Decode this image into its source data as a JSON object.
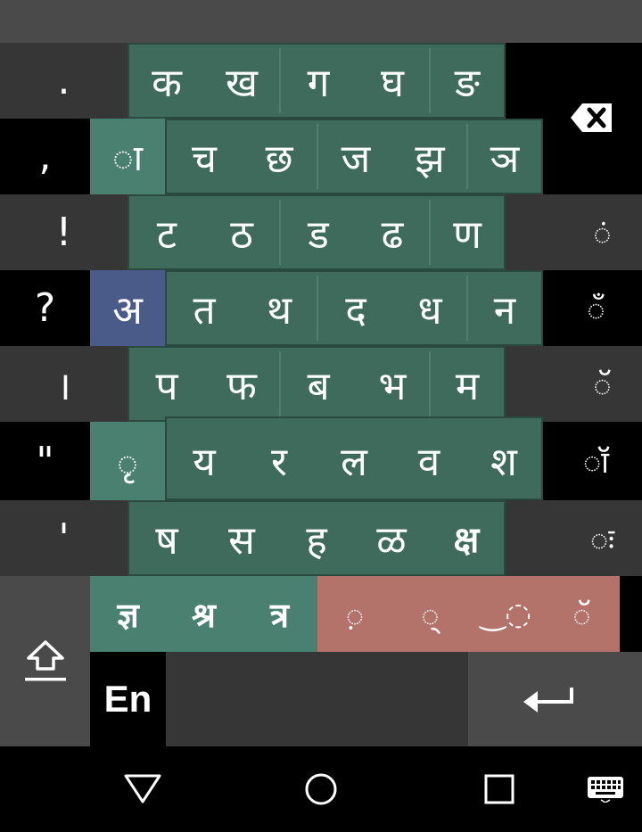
{
  "punctuation": [
    ".",
    ",",
    "!",
    "?",
    "।",
    "\"",
    "'"
  ],
  "consonant_rows": [
    [
      "क",
      "ख",
      "ग",
      "घ",
      "ङ"
    ],
    [
      "च",
      "छ",
      "ज",
      "झ",
      "ञ"
    ],
    [
      "ट",
      "ठ",
      "ड",
      "ढ",
      "ण"
    ],
    [
      "त",
      "थ",
      "द",
      "ध",
      "न"
    ],
    [
      "प",
      "फ",
      "ब",
      "भ",
      "म"
    ],
    [
      "य",
      "र",
      "ल",
      "व",
      "श"
    ],
    [
      "ष",
      "स",
      "ह",
      "ळ",
      "क्ष"
    ]
  ],
  "special_keys": {
    "aa_matra": "◌ा",
    "vowel_a": "अ",
    "ri_matra": "◌ृ"
  },
  "conjuncts": [
    "ज्ञ",
    "श्र",
    "त्र"
  ],
  "modifiers": [
    "◌़",
    "◌्",
    "‿◌",
    "◌ॅ"
  ],
  "right_signs": [
    "◌ं",
    "◌ँ",
    "◌ॅ",
    "◌ॉ",
    "◌ः"
  ],
  "language_key": "En",
  "icons": {
    "backspace": "backspace-icon",
    "shift": "shift-icon",
    "enter": "enter-icon",
    "nav_back": "back-triangle-icon",
    "nav_home": "home-circle-icon",
    "nav_recents": "recents-square-icon",
    "nav_keyboard": "keyboard-icon"
  },
  "colors": {
    "consonant_key_bg": "#3f6b5c",
    "matra_key_bg": "#4a8070",
    "vowel_key_bg": "#4a5b8a",
    "modifier_bg": "#b3736b",
    "dark_key_bg": "#363636"
  }
}
